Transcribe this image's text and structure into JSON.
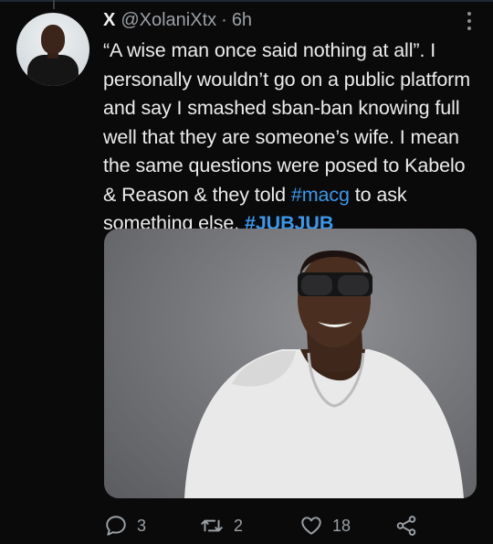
{
  "tweet": {
    "author_name": "X",
    "handle": "@XolaniXtx",
    "separator": "·",
    "time": "6h",
    "text_segments": [
      {
        "text": "“A wise man once said nothing at all”. I personally wouldn’t go on a public platform and say I smashed sban-ban knowing full well that they are someone’s wife. I mean the same questions were posed to Kabelo & Reason & they told ",
        "kind": "plain"
      },
      {
        "text": "#macg",
        "kind": "hashtag"
      },
      {
        "text": " to ask something else. ",
        "kind": "plain"
      },
      {
        "text": "#JUBJUB",
        "kind": "hashtag-bold"
      }
    ],
    "actions": {
      "replies": "3",
      "retweets": "2",
      "likes": "18"
    }
  },
  "icons": {
    "more": "more-vertical-icon",
    "reply": "reply-icon",
    "retweet": "retweet-icon",
    "like": "heart-icon",
    "share": "share-icon"
  },
  "colors": {
    "background": "#0a0a0a",
    "hashtag": "#3a98ea",
    "muted": "#9aa0a6",
    "text": "#ececec"
  }
}
